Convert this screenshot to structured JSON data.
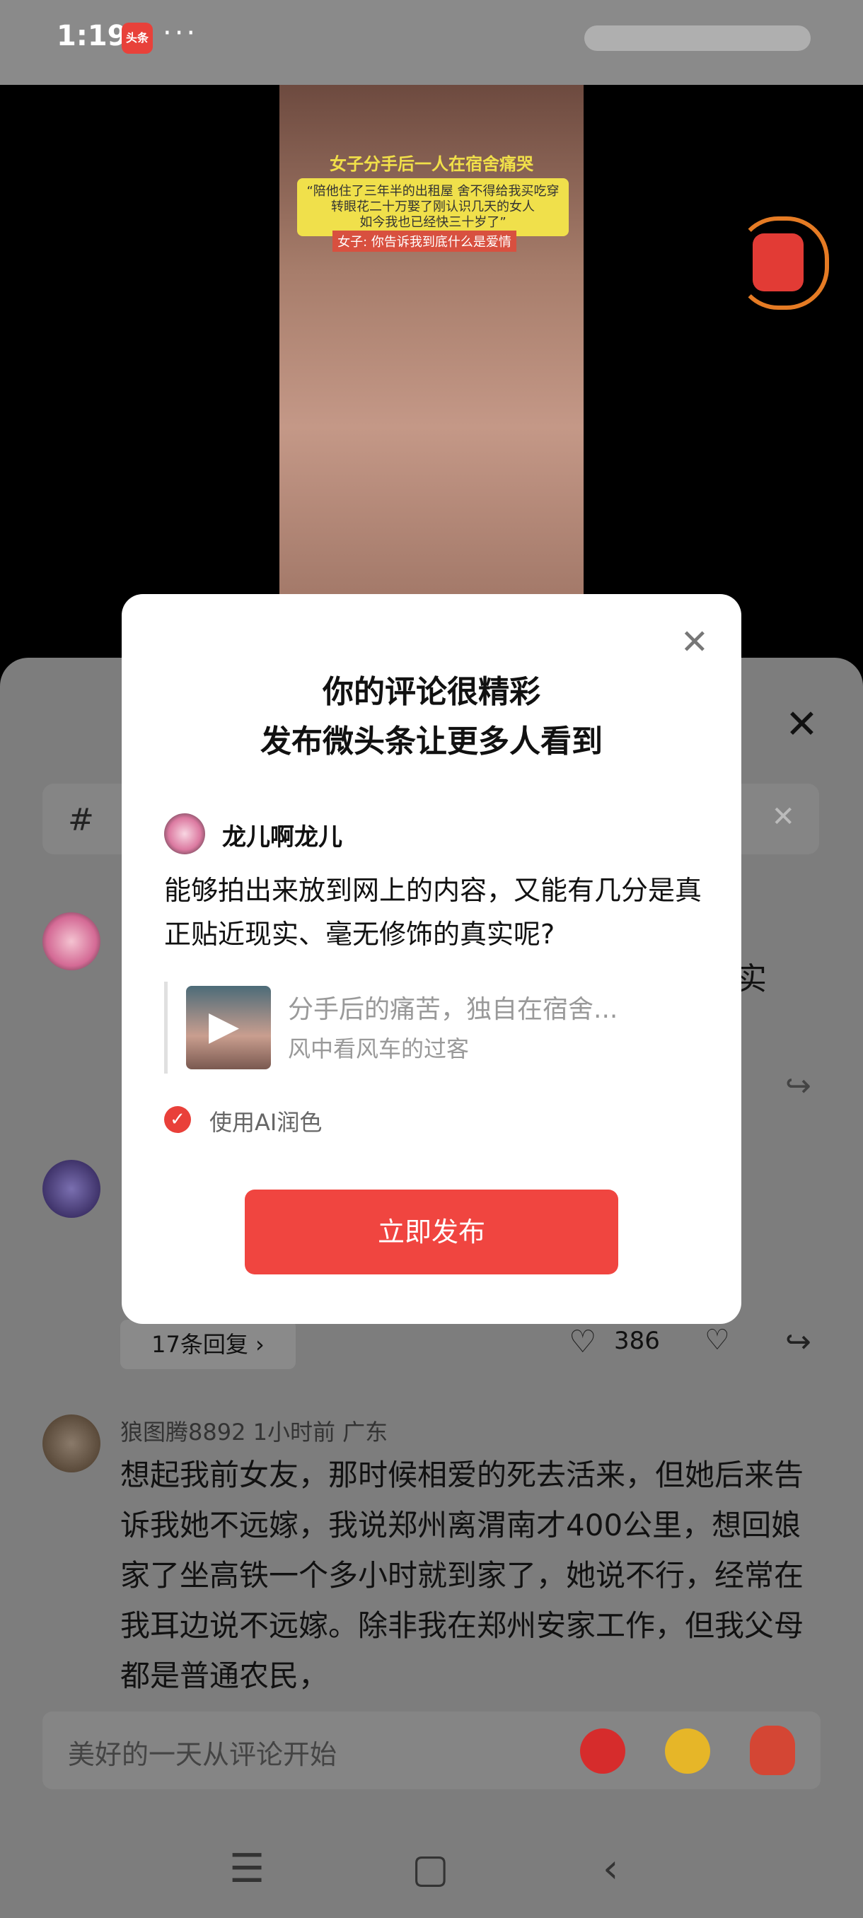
{
  "status": {
    "time": "1:19",
    "app_badge": "头条",
    "more": "···"
  },
  "video": {
    "caption_title": "女子分手后一人在宿舍痛哭",
    "caption_quote": "“陪他住了三年半的出租屋 舍不得给我买吃穿\n转眼花二十万娶了刚认识几天的女人\n如今我也已经快三十岁了”",
    "caption_sub": "女子: 你告诉我到底什么是爱情"
  },
  "sheet": {
    "close_icon": "close-icon",
    "comment1_tail": "实",
    "replies_label": "17条回复 ›",
    "like_count": "386",
    "comment3": {
      "meta": "狼图腾8892   1小时前   广东",
      "text": "想起我前女友，那时候相爱的死去活来，但她后来告诉我她不远嫁，我说郑州离渭南才400公里，想回娘家了坐高铁一个多小时就到家了，她说不行，经常在我耳边说不远嫁。除非我在郑州安家工作，但我父母都是普通农民，"
    },
    "input_placeholder": "美好的一天从评论开始"
  },
  "modal": {
    "title_line1": "你的评论很精彩",
    "title_line2": "发布微头条让更多人看到",
    "username": "龙儿啊龙儿",
    "comment": "能够拍出来放到网上的内容，又能有几分是真正贴近现实、毫无修饰的真实呢?",
    "ref_title": "分手后的痛苦，独自在宿舍...",
    "ref_author": "风中看风车的过客",
    "ai_label": "使用AI润色",
    "publish_label": "立即发布"
  },
  "nav": {
    "menu": "☰",
    "home": "▢",
    "back": "‹"
  }
}
